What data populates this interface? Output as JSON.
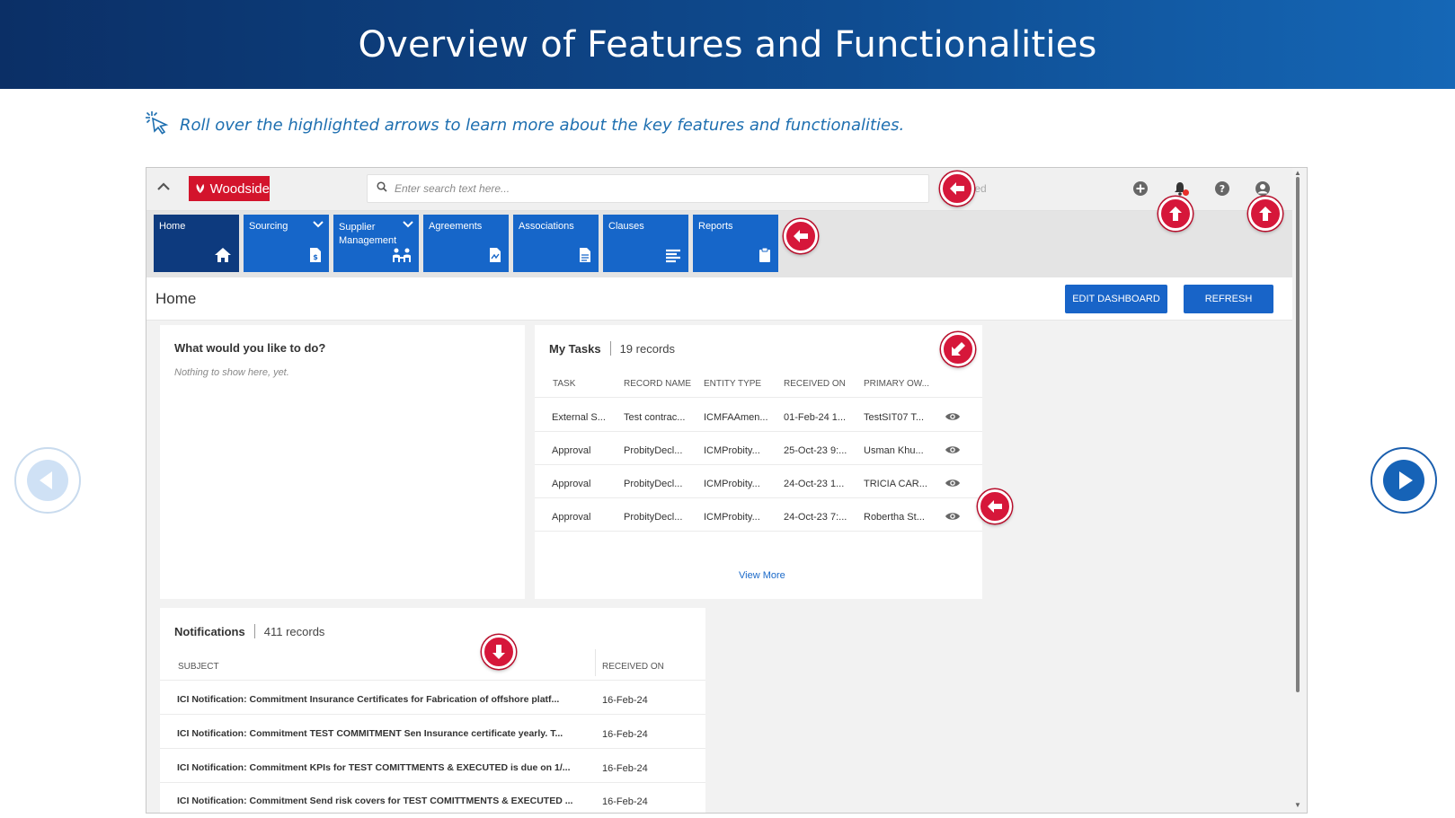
{
  "slide": {
    "title": "Overview of Features and Functionalities",
    "instruction": "Roll over the highlighted arrows to learn more about the key features and functionalities."
  },
  "app": {
    "logo_text": "Woodside",
    "search_placeholder": "Enter search text here...",
    "ghost_text": "ted",
    "nav": [
      {
        "label": "Home",
        "icon": "home-icon"
      },
      {
        "label": "Sourcing",
        "icon": "sourcing-doc-icon"
      },
      {
        "label": "Supplier Management",
        "icon": "people-icon"
      },
      {
        "label": "Agreements",
        "icon": "agreement-doc-icon"
      },
      {
        "label": "Associations",
        "icon": "document-icon"
      },
      {
        "label": "Clauses",
        "icon": "text-lines-icon"
      },
      {
        "label": "Reports",
        "icon": "clipboard-icon"
      }
    ],
    "page_title": "Home",
    "edit_dashboard": "EDIT DASHBOARD",
    "refresh": "REFRESH"
  },
  "what_todo": {
    "title": "What would you like to do?",
    "empty": "Nothing to show here, yet."
  },
  "tasks": {
    "title": "My Tasks",
    "count": "19 records",
    "columns": [
      "TASK",
      "RECORD NAME",
      "ENTITY TYPE",
      "RECEIVED ON",
      "PRIMARY OW..."
    ],
    "rows": [
      [
        "External S...",
        "Test contrac...",
        "ICMFAAmen...",
        "01-Feb-24 1...",
        "TestSIT07 T..."
      ],
      [
        "Approval",
        "ProbityDecl...",
        "ICMProbity...",
        "25-Oct-23 9:...",
        "Usman Khu..."
      ],
      [
        "Approval",
        "ProbityDecl...",
        "ICMProbity...",
        "24-Oct-23 1...",
        "TRICIA CAR..."
      ],
      [
        "Approval",
        "ProbityDecl...",
        "ICMProbity...",
        "24-Oct-23 7:...",
        "Robertha St..."
      ]
    ],
    "view_more": "View More"
  },
  "notifications": {
    "title": "Notifications",
    "count": "411 records",
    "columns": [
      "SUBJECT",
      "RECEIVED ON"
    ],
    "rows": [
      [
        "ICI Notification: Commitment Insurance Certificates for Fabrication of offshore platf...",
        "16-Feb-24"
      ],
      [
        "ICI Notification: Commitment TEST COMMITMENT Sen Insurance certificate yearly. T...",
        "16-Feb-24"
      ],
      [
        "ICI Notification: Commitment KPIs for TEST COMITTMENTS & EXECUTED is due on 1/...",
        "16-Feb-24"
      ],
      [
        "ICI Notification: Commitment Send risk covers for TEST COMITTMENTS & EXECUTED ...",
        "16-Feb-24"
      ]
    ]
  },
  "colors": {
    "banner": "#0b2f66",
    "accent_blue": "#1666c9",
    "nav_active": "#0d3a7e",
    "hotspot_red": "#d6173a",
    "brand_red": "#d3142c"
  }
}
